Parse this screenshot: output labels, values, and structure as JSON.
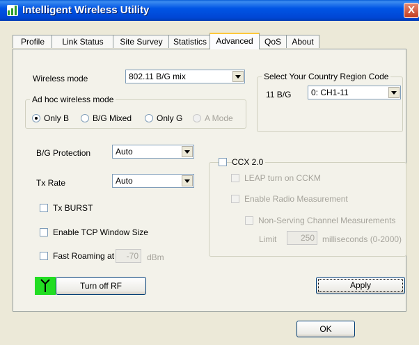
{
  "window": {
    "title": "Intelligent Wireless Utility",
    "close_glyph": "X"
  },
  "tabs": [
    {
      "label": "Profile"
    },
    {
      "label": "Link Status"
    },
    {
      "label": "Site Survey"
    },
    {
      "label": "Statistics"
    },
    {
      "label": "Advanced",
      "active": true
    },
    {
      "label": "QoS"
    },
    {
      "label": "About"
    }
  ],
  "wireless_mode": {
    "label": "Wireless mode",
    "value": "802.11 B/G mix"
  },
  "adhoc": {
    "legend": "Ad hoc wireless mode",
    "options": [
      "Only B",
      "B/G Mixed",
      "Only G",
      "A Mode"
    ],
    "selected": "Only B"
  },
  "country": {
    "legend": "Select Your Country Region Code",
    "label": "11 B/G",
    "value": "0: CH1-11"
  },
  "bg_protection": {
    "label": "B/G Protection",
    "value": "Auto"
  },
  "tx_rate": {
    "label": "Tx Rate",
    "value": "Auto"
  },
  "tx_burst": {
    "label": "Tx BURST",
    "checked": false
  },
  "tcp_window": {
    "label": "Enable TCP Window Size",
    "checked": false
  },
  "fast_roaming": {
    "label": "Fast Roaming at",
    "value": "-70",
    "unit": "dBm",
    "checked": false
  },
  "rf_button": {
    "label": "Turn off RF",
    "icon": "antenna-icon",
    "icon_color": "#22dd22"
  },
  "ccx": {
    "label": "CCX 2.0",
    "checked": false,
    "leap": "LEAP turn on CCKM",
    "radio_measurement": "Enable Radio Measurement",
    "non_serving": "Non-Serving Channel Measurements",
    "limit_label": "Limit",
    "limit_value": "250",
    "limit_unit": "milliseconds (0-2000)"
  },
  "apply_button": {
    "label": "Apply"
  },
  "ok_button": {
    "label": "OK"
  }
}
